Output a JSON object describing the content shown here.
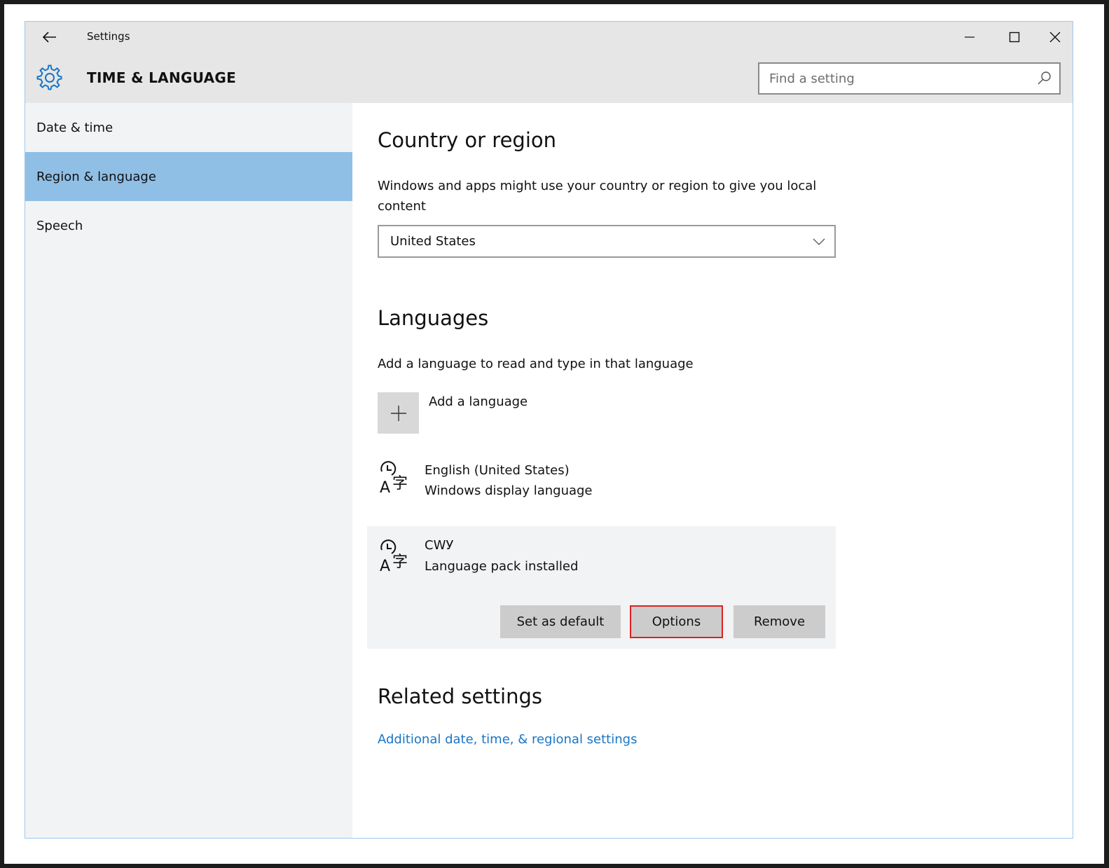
{
  "window": {
    "app_title": "Settings",
    "icons": {
      "back": "back-arrow-icon",
      "minimize": "minimize-icon",
      "maximize": "maximize-icon",
      "close": "close-icon"
    }
  },
  "header": {
    "section_title": "TIME & LANGUAGE",
    "icon": "gear-icon",
    "search_placeholder": "Find a setting",
    "search_value": ""
  },
  "sidebar": {
    "items": [
      {
        "label": "Date & time",
        "active": false
      },
      {
        "label": "Region & language",
        "active": true
      },
      {
        "label": "Speech",
        "active": false
      }
    ]
  },
  "country": {
    "heading": "Country or region",
    "description": "Windows and apps might use your country or region to give you local content",
    "selected": "United States"
  },
  "languages": {
    "heading": "Languages",
    "description": "Add a language to read and type in that language",
    "add_label": "Add a language",
    "items": [
      {
        "name": "English (United States)",
        "status": "Windows display language"
      },
      {
        "name": "СWУ",
        "status": "Language pack installed"
      }
    ],
    "actions": {
      "set_default": "Set as default",
      "options": "Options",
      "remove": "Remove"
    }
  },
  "related": {
    "heading": "Related settings",
    "link": "Additional date, time, & regional settings"
  },
  "colors": {
    "accent": "#1976c6",
    "active_nav": "#90bfe6",
    "focus_outline": "#e02020"
  }
}
